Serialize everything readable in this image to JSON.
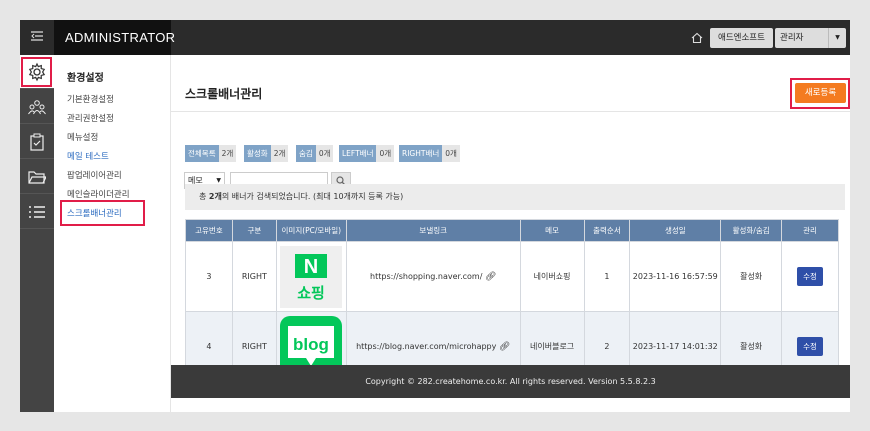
{
  "header": {
    "menu_toggle_icon": "menu-collapse-icon",
    "brand": "ADMINISTRATOR",
    "home_icon": "home-icon",
    "company_button": "애드엔소프트",
    "admin_dropdown": "관리자"
  },
  "iconbar": {
    "items": [
      {
        "icon": "gear-icon",
        "active": true
      },
      {
        "icon": "users-icon",
        "active": false
      },
      {
        "icon": "clipboard-icon",
        "active": false
      },
      {
        "icon": "folder-icon",
        "active": false
      },
      {
        "icon": "list-icon",
        "active": false
      }
    ]
  },
  "sidebar": {
    "title": "환경설정",
    "items": [
      {
        "label": "기본환경설정"
      },
      {
        "label": "관리권한설정"
      },
      {
        "label": "메뉴설정"
      },
      {
        "label": "메일 테스트"
      },
      {
        "label": "팝업레이어관리"
      },
      {
        "label": "메인슬라이더관리"
      },
      {
        "label": "스크롤배너관리"
      }
    ]
  },
  "page": {
    "title": "스크롤배너관리",
    "new_button": "새로등록"
  },
  "filters": [
    {
      "label": "전체목록",
      "count": "2개"
    },
    {
      "label": "활성화",
      "count": "2개"
    },
    {
      "label": "숨김",
      "count": "0개"
    },
    {
      "label": "LEFT배너",
      "count": "0개"
    },
    {
      "label": "RIGHT배너",
      "count": "0개"
    }
  ],
  "search": {
    "select_value": "메모",
    "input_value": ""
  },
  "info": {
    "prefix": "총 ",
    "count": "2개",
    "suffix": "의 배너가 검색되었습니다. (최대 10개까지 등록 가능)"
  },
  "table": {
    "headers": [
      "고유번호",
      "구분",
      "이미지(PC/모바일)",
      "보낼링크",
      "메모",
      "출력순서",
      "생성일",
      "활성화/숨김",
      "관리"
    ],
    "rows": [
      {
        "id": "3",
        "type": "RIGHT",
        "image": "naver-shopping-logo",
        "image_text_top": "N",
        "image_text_bottom": "쇼핑",
        "link": "https://shopping.naver.com/",
        "memo": "네이버쇼핑",
        "order": "1",
        "created": "2023-11-16 16:57:59",
        "status": "활성화",
        "action": "수정"
      },
      {
        "id": "4",
        "type": "RIGHT",
        "image": "naver-blog-logo",
        "image_text": "blog",
        "link": "https://blog.naver.com/microhappy",
        "memo": "네이버블로그",
        "order": "2",
        "created": "2023-11-17 14:01:32",
        "status": "활성화",
        "action": "수정"
      }
    ]
  },
  "footer": {
    "text": "Copyright © 282.createhome.co.kr. All rights reserved. Version 5.5.8.2.3"
  },
  "colors": {
    "accent_orange": "#f47b20",
    "highlight_red": "#e11d48",
    "table_header": "#5f7fa6",
    "edit_button": "#2f4fa8",
    "naver_green": "#03c75a"
  }
}
